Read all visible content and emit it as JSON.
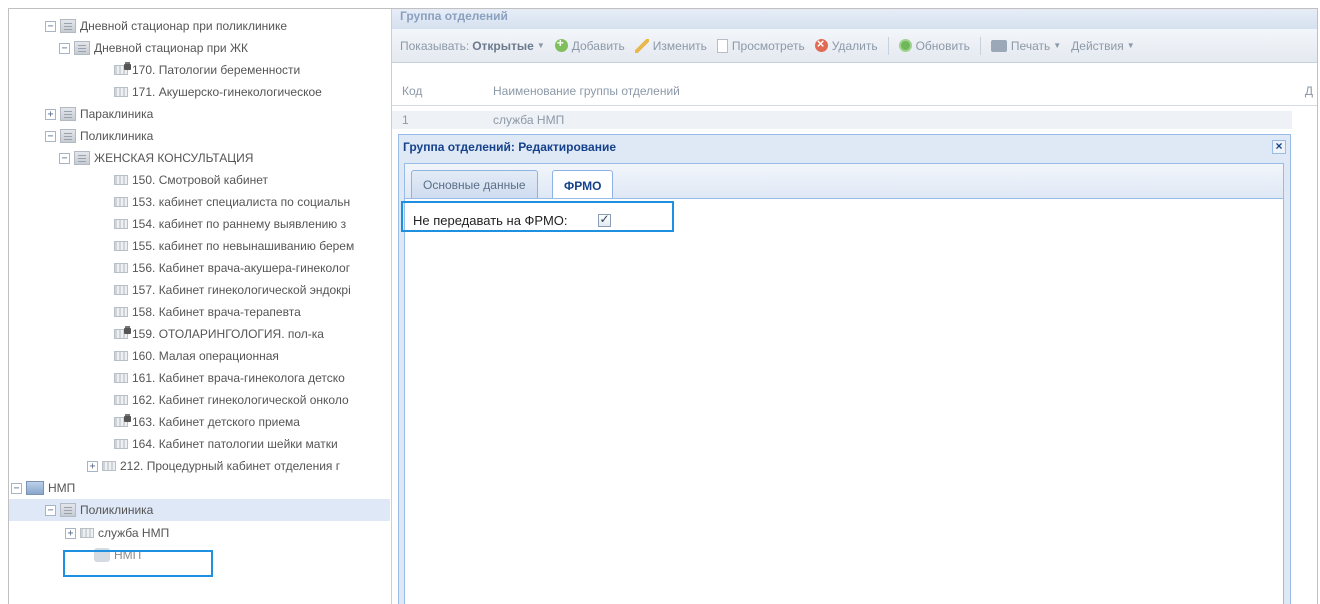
{
  "tree": {
    "items": [
      {
        "label": "Дневной стационар при поликлинике",
        "toggle": "−",
        "icon": "folder"
      },
      {
        "label": "Дневной стационар при ЖК",
        "toggle": "−",
        "icon": "folder"
      },
      {
        "label": "170. Патологии беременности",
        "toggle": "",
        "icon": "locked"
      },
      {
        "label": "171. Акушерско-гинекологическое",
        "toggle": "",
        "icon": "room"
      },
      {
        "label": "Параклиника",
        "toggle": "+",
        "icon": "folder"
      },
      {
        "label": "Поликлиника",
        "toggle": "−",
        "icon": "folder"
      },
      {
        "label": "ЖЕНСКАЯ КОНСУЛЬТАЦИЯ",
        "toggle": "−",
        "icon": "folder"
      },
      {
        "label": "150. Смотровой кабинет",
        "toggle": "",
        "icon": "room"
      },
      {
        "label": "153. кабинет специалиста по социальн",
        "toggle": "",
        "icon": "room"
      },
      {
        "label": "154. кабинет по раннему выявлению з",
        "toggle": "",
        "icon": "room"
      },
      {
        "label": "155. кабинет по невынашиванию берем",
        "toggle": "",
        "icon": "room"
      },
      {
        "label": "156. Кабинет врача-акушера-гинеколог",
        "toggle": "",
        "icon": "room"
      },
      {
        "label": "157. Кабинет гинекологической эндокрі",
        "toggle": "",
        "icon": "room"
      },
      {
        "label": "158. Кабинет врача-терапевта",
        "toggle": "",
        "icon": "room"
      },
      {
        "label": "159. ОТОЛАРИНГОЛОГИЯ. пол-ка",
        "toggle": "",
        "icon": "locked"
      },
      {
        "label": "160. Малая операционная",
        "toggle": "",
        "icon": "room"
      },
      {
        "label": "161. Кабинет врача-гинеколога детско",
        "toggle": "",
        "icon": "room"
      },
      {
        "label": "162. Кабинет гинекологической онколо",
        "toggle": "",
        "icon": "room"
      },
      {
        "label": "163. Кабинет детского приема",
        "toggle": "",
        "icon": "locked"
      },
      {
        "label": "164. Кабинет патологии шейки матки",
        "toggle": "",
        "icon": "room"
      },
      {
        "label": "212. Процедурный кабинет отделения г",
        "toggle": "+",
        "icon": "room"
      },
      {
        "label": "НМП",
        "toggle": "−",
        "icon": "nmp"
      },
      {
        "label": "Поликлиника",
        "toggle": "−",
        "icon": "folder"
      },
      {
        "label": "служба НМП",
        "toggle": "+",
        "icon": "room"
      },
      {
        "label": "НМП",
        "toggle": "",
        "icon": "nmp-dim"
      }
    ]
  },
  "panel": {
    "title": "Группа отделений",
    "toolbar": {
      "show_label": "Показывать:",
      "show_value": "Открытые",
      "add": "Добавить",
      "edit": "Изменить",
      "view": "Просмотреть",
      "delete": "Удалить",
      "refresh": "Обновить",
      "print": "Печать",
      "actions": "Действия"
    },
    "grid": {
      "columns": [
        "Код",
        "Наименование группы отделений",
        "Д"
      ],
      "rows": [
        {
          "code": "1",
          "name": "служба НМП"
        }
      ]
    }
  },
  "dialog": {
    "title": "Группа отделений: Редактирование",
    "close": "×",
    "tabs": [
      "Основные данные",
      "ФРМО"
    ],
    "active_tab": "ФРМО",
    "field_label": "Не передавать на ФРМО:",
    "checked": true
  },
  "colors": {
    "highlight": "#1f8fe0",
    "dialog_title": "#15428b",
    "selected_row": "#dfe8f6"
  }
}
